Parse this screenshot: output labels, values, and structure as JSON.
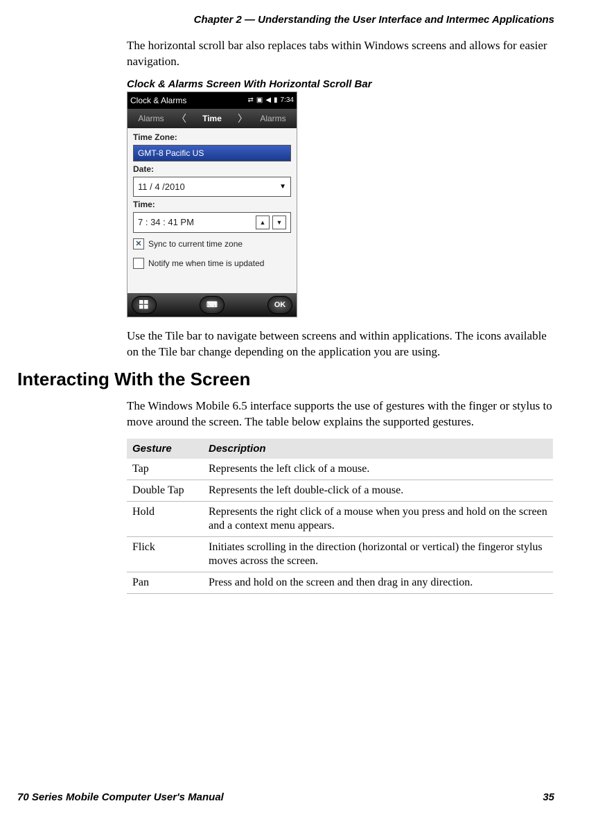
{
  "header": "Chapter 2 — Understanding the User Interface and Intermec Applications",
  "para1": "The horizontal scroll bar also replaces tabs within Windows screens and allows for easier navigation.",
  "caption1": "Clock & Alarms Screen With Horizontal Scroll Bar",
  "screenshot": {
    "title": "Clock & Alarms",
    "clock": "7:34",
    "tab_left": "Alarms",
    "tab_center": "Time",
    "tab_right": "Alarms",
    "tz_label": "Time Zone:",
    "tz_value": "GMT-8 Pacific US",
    "date_label": "Date:",
    "date_value": "11  /  4   /2010",
    "time_label": "Time:",
    "time_value": "7   : 34  : 41    PM",
    "sync_label": "Sync to current time zone",
    "notify_label": "Notify me when time is updated",
    "ok_label": "OK"
  },
  "para2": "Use the Tile bar to navigate between screens and within applications. The icons available on the Tile bar change depending on the application you are using.",
  "section_heading": "Interacting With the Screen",
  "para3": "The Windows Mobile 6.5 interface supports the use of gestures with the finger or stylus to move around the screen. The table below explains the supported gestures.",
  "table": {
    "col1": "Gesture",
    "col2": "Description",
    "rows": [
      {
        "gesture": "Tap",
        "desc": "Represents the left click of a mouse."
      },
      {
        "gesture": "Double Tap",
        "desc": "Represents the left double-click of a mouse."
      },
      {
        "gesture": "Hold",
        "desc": "Represents the right click of a mouse when you press and hold on the screen and a context menu appears."
      },
      {
        "gesture": "Flick",
        "desc": "Initiates scrolling in the direction (horizontal or vertical) the fingeror stylus moves across the screen."
      },
      {
        "gesture": "Pan",
        "desc": "Press and hold on the screen and then drag in any direction."
      }
    ]
  },
  "footer_left": "70 Series Mobile Computer User's Manual",
  "footer_right": "35"
}
